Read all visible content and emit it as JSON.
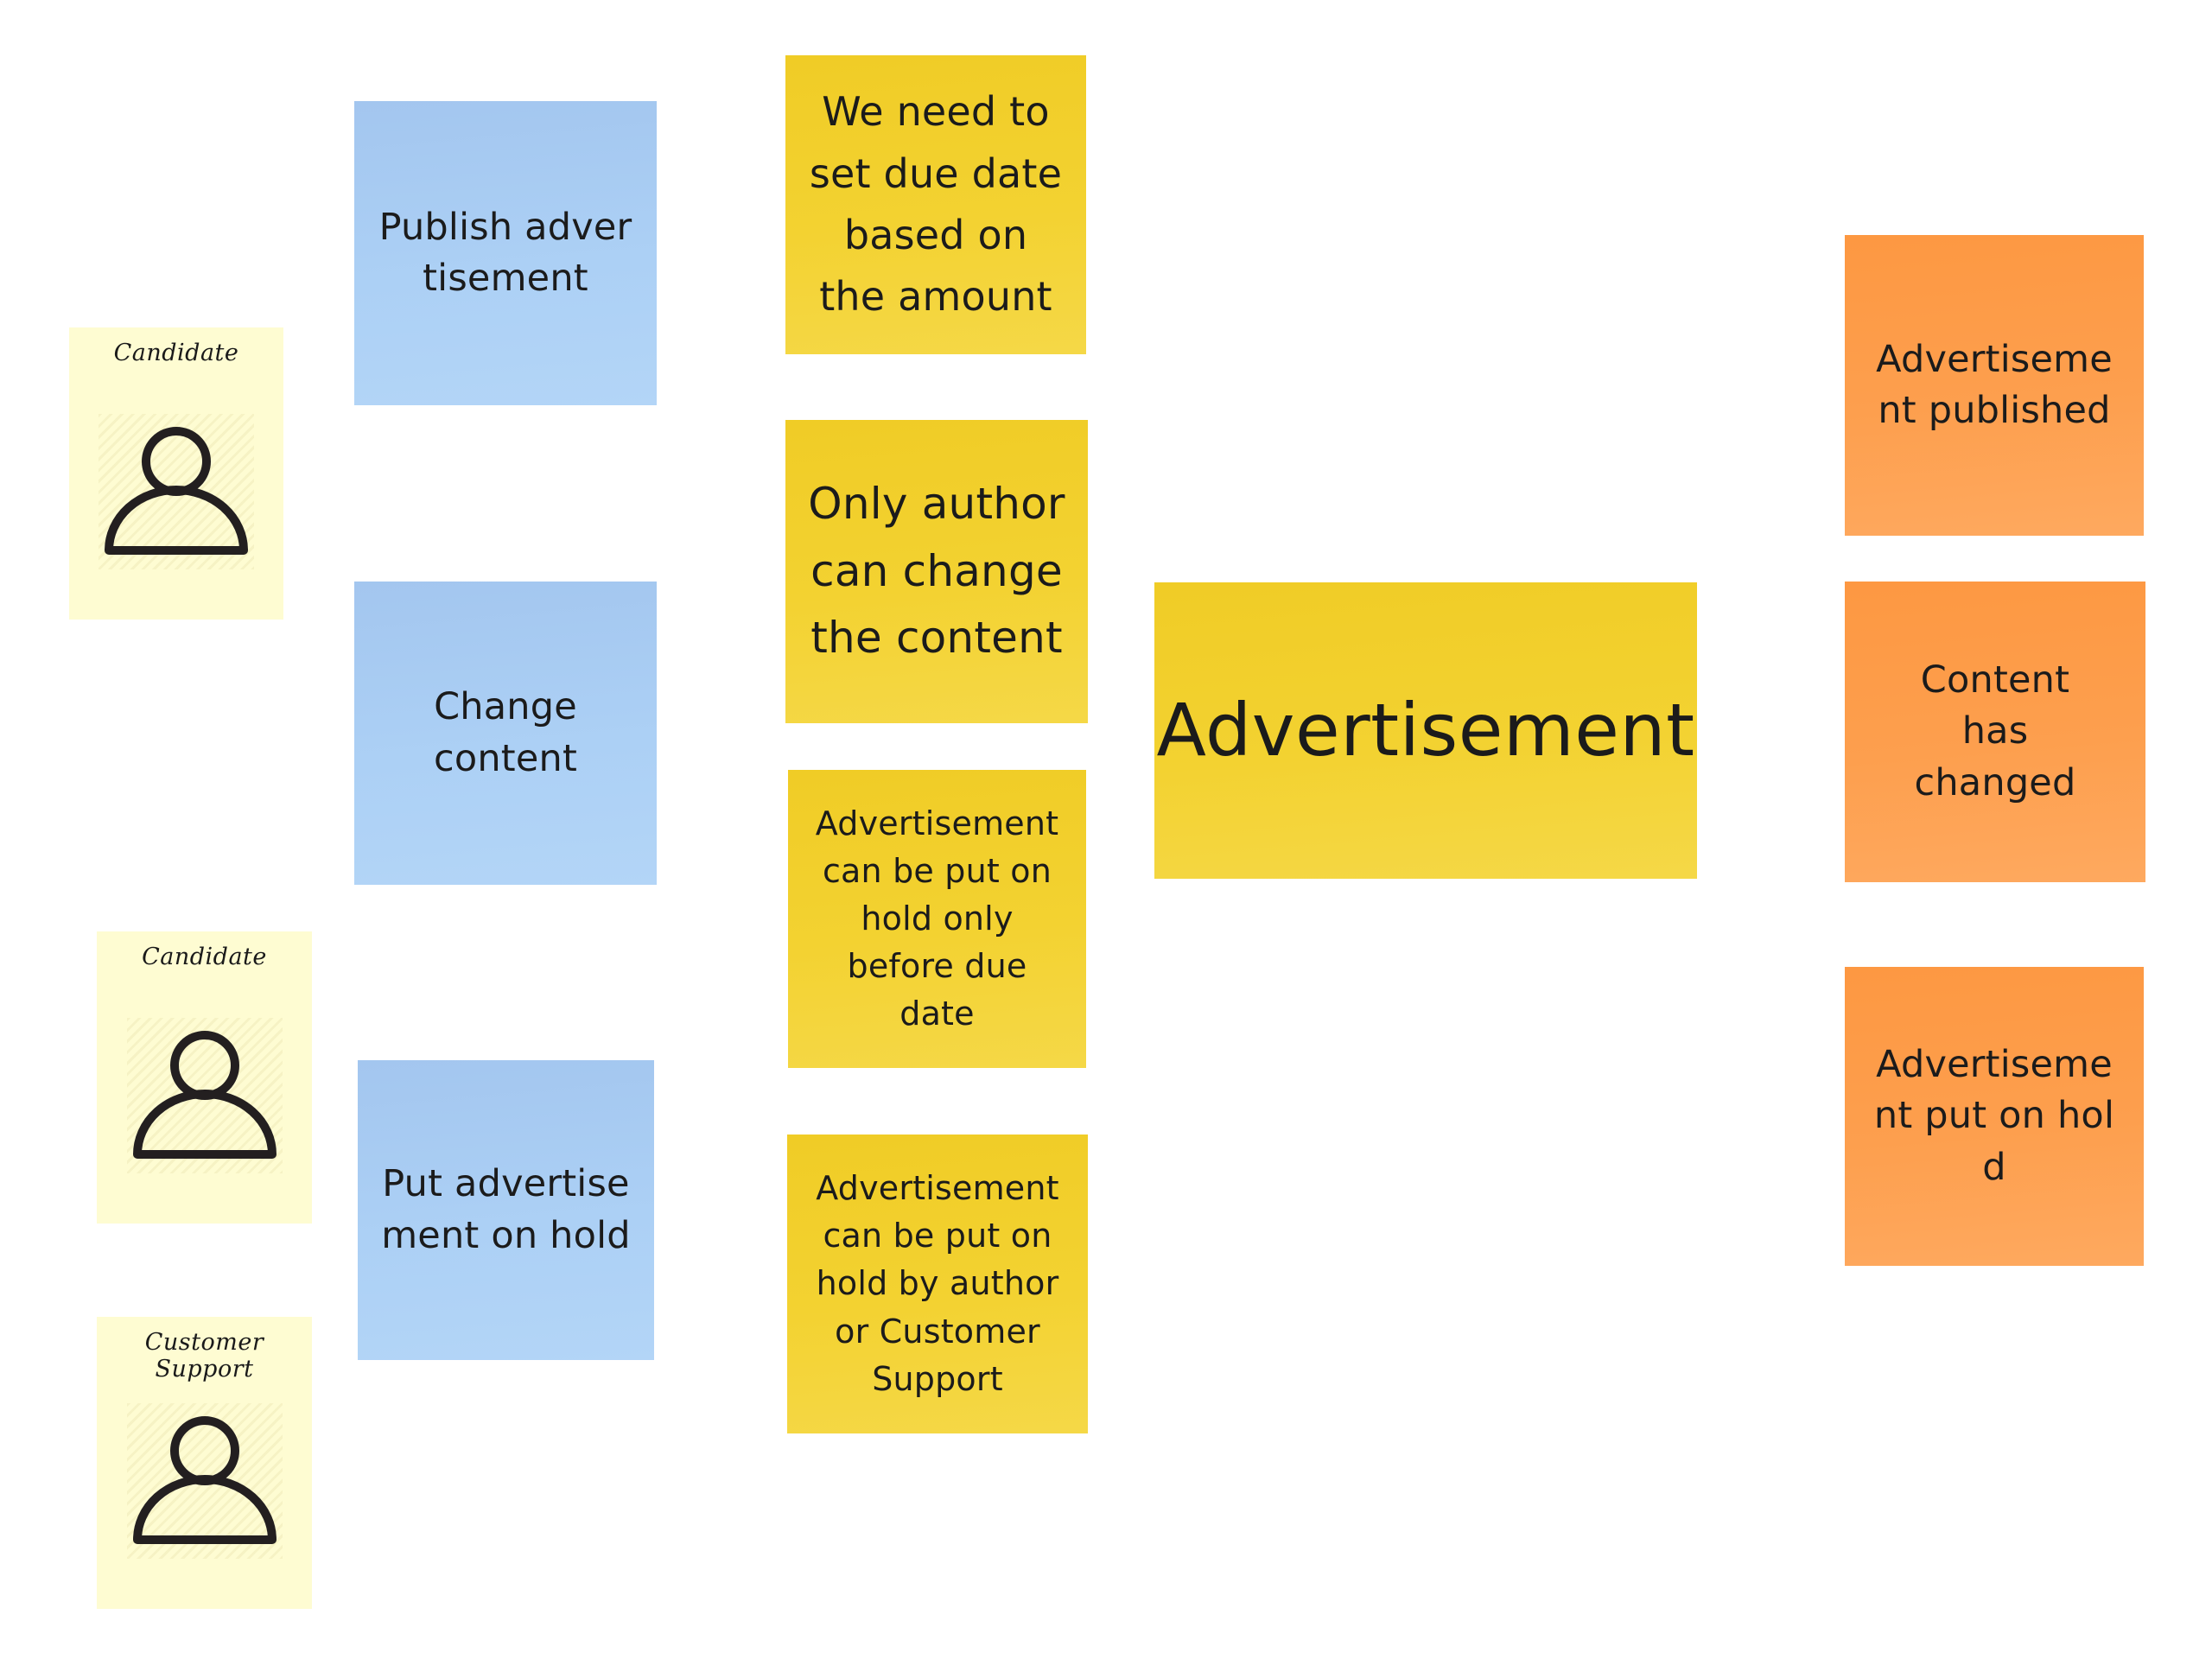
{
  "board": {
    "background": "#ffffff"
  },
  "colors": {
    "command": "#a7c9f0",
    "policy": "#f2d02e",
    "aggregate": "#f2d02e",
    "event": "#fd9a45",
    "actor": "#fefcd2"
  },
  "actors": [
    {
      "label": "Candidate",
      "icon": "person-icon"
    },
    {
      "label": "Candidate",
      "icon": "person-icon"
    },
    {
      "label": "Customer Support",
      "icon": "person-icon"
    }
  ],
  "commands": [
    {
      "text": "Publish advertisement"
    },
    {
      "text": "Change content"
    },
    {
      "text": "Put advertisement on hold"
    }
  ],
  "policies": [
    {
      "text": "We need to set due date based on the amount"
    },
    {
      "text": "Only author can change the content"
    },
    {
      "text": "Advertisement can be put on hold only before due date"
    },
    {
      "text": "Advertisement can be put on hold by author or Customer Support"
    }
  ],
  "aggregate": {
    "text": "Advertisement"
  },
  "events": [
    {
      "text": "Advertisement published"
    },
    {
      "text": "Content has changed"
    },
    {
      "text": "Advertisement put on hold"
    }
  ]
}
